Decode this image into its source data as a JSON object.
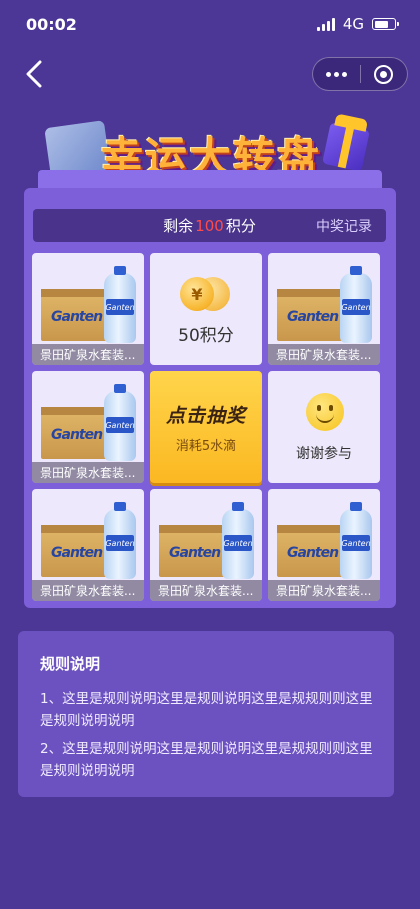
{
  "status_bar": {
    "time": "00:02",
    "network": "4G"
  },
  "nav": {
    "back_icon": "chevron-left-icon",
    "more_icon": "more-dots-icon",
    "close_icon": "target-icon"
  },
  "banner": {
    "title": "幸运大转盘"
  },
  "score_bar": {
    "prefix": "剩余",
    "points": "100",
    "suffix": "积分",
    "records_link": "中奖记录"
  },
  "grid": {
    "prize_label": "景田矿泉水套装...",
    "brand_text": "Ganten",
    "points_prize": {
      "label": "50积分",
      "coin_symbol": "¥"
    },
    "draw_button": {
      "title": "点击抽奖",
      "cost": "消耗5水滴"
    },
    "thanks": {
      "label": "谢谢参与"
    }
  },
  "rules": {
    "title": "规则说明",
    "items": [
      "1、这里是规则说明这里是规则说明这里是规规则则这里是规则说明说明",
      "2、这里是规则说明这里是规则说明这里是规规则则这里是规则说明说明"
    ]
  },
  "colors": {
    "background": "#4c3696",
    "panel": "#7c5fd9",
    "accent_gold": "#fbb822",
    "points_red": "#ff4a4a"
  }
}
